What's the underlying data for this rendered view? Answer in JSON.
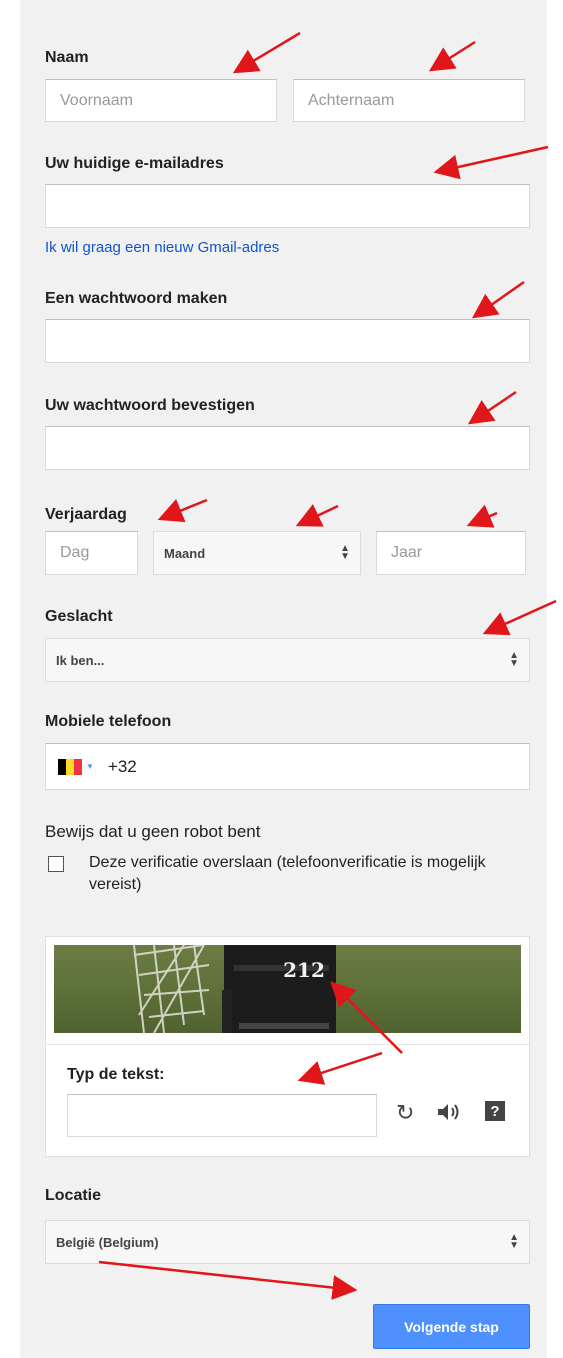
{
  "name": {
    "label": "Naam",
    "first_placeholder": "Voornaam",
    "last_placeholder": "Achternaam"
  },
  "email": {
    "label": "Uw huidige e-mailadres",
    "value": "",
    "gmail_link": "Ik wil graag een nieuw Gmail-adres"
  },
  "password": {
    "create_label": "Een wachtwoord maken",
    "confirm_label": "Uw wachtwoord bevestigen"
  },
  "birthday": {
    "label": "Verjaardag",
    "day_placeholder": "Dag",
    "month_value": "Maand",
    "year_placeholder": "Jaar"
  },
  "gender": {
    "label": "Geslacht",
    "value": "Ik ben..."
  },
  "phone": {
    "label": "Mobiele telefoon",
    "country_code": "+32",
    "flag_colors": [
      "#000000",
      "#fdda24",
      "#ef3340"
    ]
  },
  "robot": {
    "label": "Bewijs dat u geen robot bent",
    "skip_text": "Deze verificatie overslaan (telefoonverificatie is mogelijk vereist)",
    "captcha_text": "212",
    "type_label": "Typ de tekst:"
  },
  "location": {
    "label": "Locatie",
    "value": "België (Belgium)"
  },
  "submit": {
    "label": "Volgende stap"
  },
  "colors": {
    "accent": "#4d90fe",
    "link": "#1155cc",
    "annotation_arrow": "#e0161b"
  }
}
